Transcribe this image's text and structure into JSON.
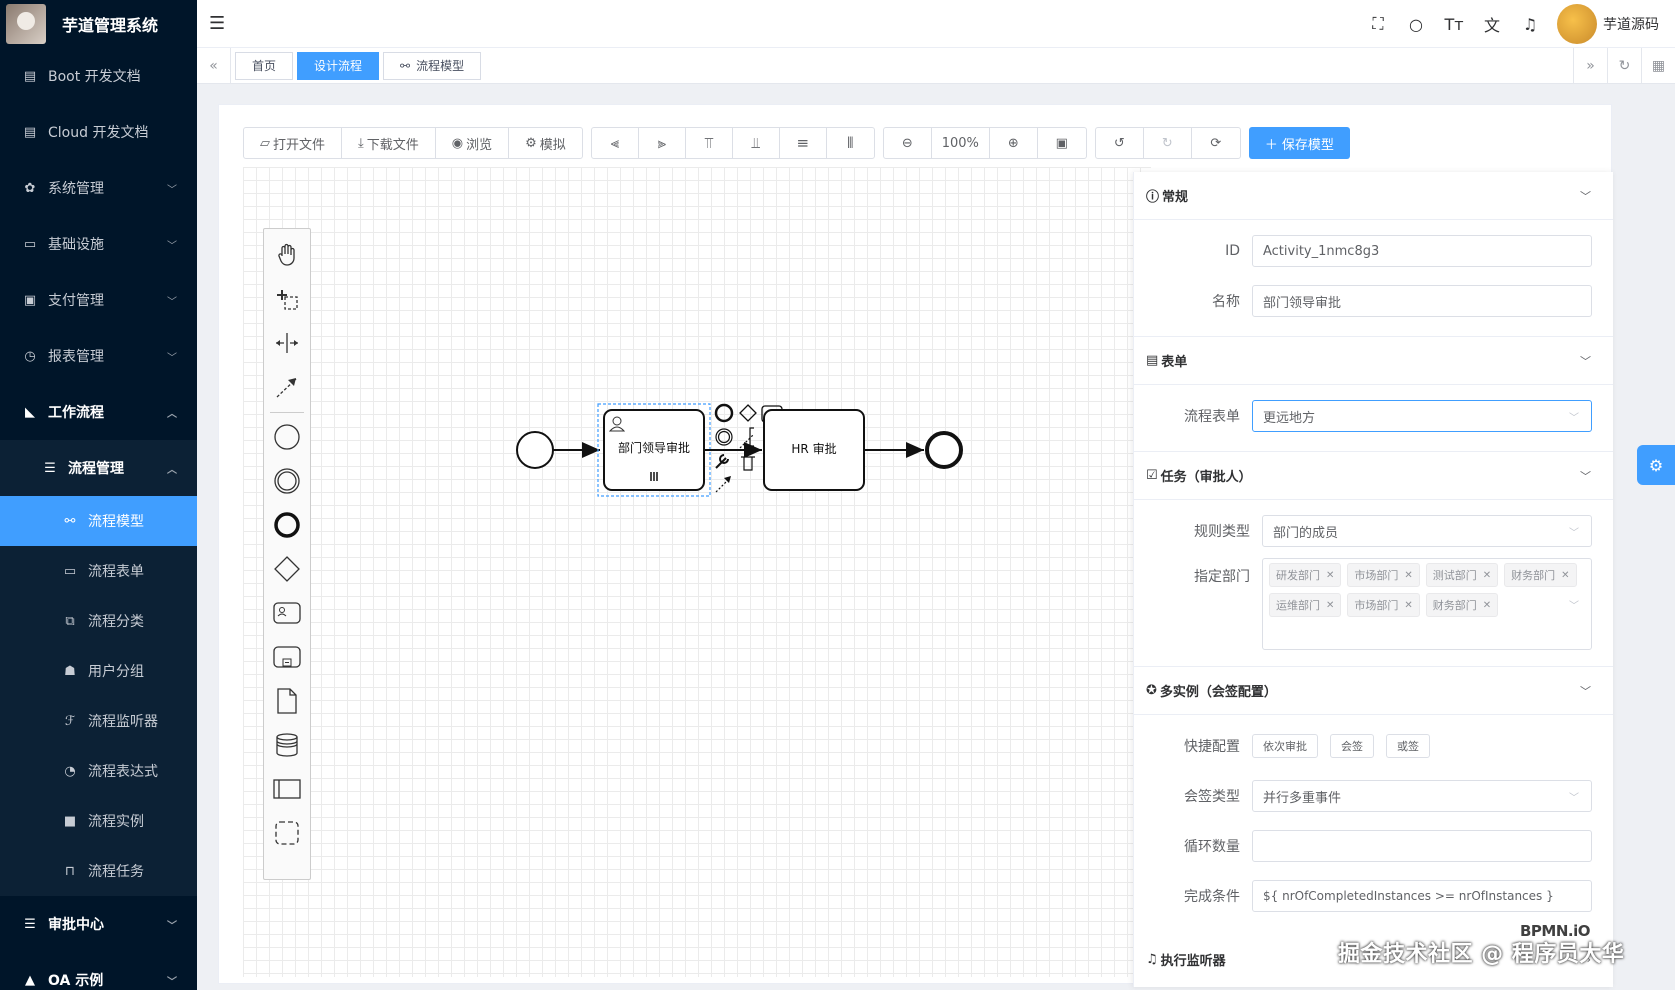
{
  "app": {
    "title": "芋道管理系统"
  },
  "sidebar": {
    "items": [
      {
        "label": "Boot 开发文档",
        "icon": "document-icon"
      },
      {
        "label": "Cloud 开发文档",
        "icon": "document-icon"
      },
      {
        "label": "系统管理",
        "icon": "gear-icon"
      },
      {
        "label": "基础设施",
        "icon": "monitor-icon"
      },
      {
        "label": "支付管理",
        "icon": "payment-icon"
      },
      {
        "label": "报表管理",
        "icon": "clock-icon"
      },
      {
        "label": "工作流程",
        "icon": "workflow-icon"
      }
    ],
    "workflow_sub": {
      "label": "流程管理"
    },
    "workflow_children": [
      {
        "label": "流程模型",
        "icon": "model-icon"
      },
      {
        "label": "流程表单",
        "icon": "form-icon"
      },
      {
        "label": "流程分类",
        "icon": "category-icon"
      },
      {
        "label": "用户分组",
        "icon": "group-icon"
      },
      {
        "label": "流程监听器",
        "icon": "listener-icon"
      },
      {
        "label": "流程表达式",
        "icon": "expression-icon"
      },
      {
        "label": "流程实例",
        "icon": "instance-icon"
      },
      {
        "label": "流程任务",
        "icon": "task-icon"
      }
    ],
    "bottom": [
      {
        "label": "审批中心",
        "icon": "approval-icon"
      },
      {
        "label": "OA 示例",
        "icon": "oa-icon"
      }
    ]
  },
  "header": {
    "user_name": "芋道源码"
  },
  "tags": [
    {
      "label": "首页"
    },
    {
      "label": "设计流程"
    },
    {
      "label": "流程模型"
    }
  ],
  "toolbar": {
    "open_file": "打开文件",
    "download_file": "下载文件",
    "preview": "浏览",
    "simulate": "模拟",
    "zoom": "100%",
    "save_model": "保存模型"
  },
  "diagram": {
    "task1": "部门领导审批",
    "task2": "HR 审批"
  },
  "properties": {
    "general": {
      "title": "常规",
      "id_label": "ID",
      "id_value": "Activity_1nmc8g3",
      "name_label": "名称",
      "name_value": "部门领导审批"
    },
    "form": {
      "title": "表单",
      "label": "流程表单",
      "value": "更远地方"
    },
    "task": {
      "title": "任务（审批人）",
      "rule_label": "规则类型",
      "rule_value": "部门的成员",
      "dept_label": "指定部门",
      "depts": [
        "研发部门",
        "市场部门",
        "测试部门",
        "财务部门",
        "运维部门",
        "市场部门",
        "财务部门"
      ]
    },
    "multi": {
      "title": "多实例（会签配置）",
      "quick_label": "快捷配置",
      "quick_buttons": [
        "依次审批",
        "会签",
        "或签"
      ],
      "type_label": "会签类型",
      "type_value": "并行多重事件",
      "loop_label": "循环数量",
      "loop_value": "",
      "complete_label": "完成条件",
      "complete_value": "${ nrOfCompletedInstances >= nrOfInstances }"
    },
    "listener": {
      "title": "执行监听器"
    }
  },
  "watermark": "掘金技术社区 @ 程序员大华",
  "bpmn_logo": "BPMN.iO",
  "colors": {
    "primary": "#409eff",
    "sidebar_bg": "#001529"
  }
}
